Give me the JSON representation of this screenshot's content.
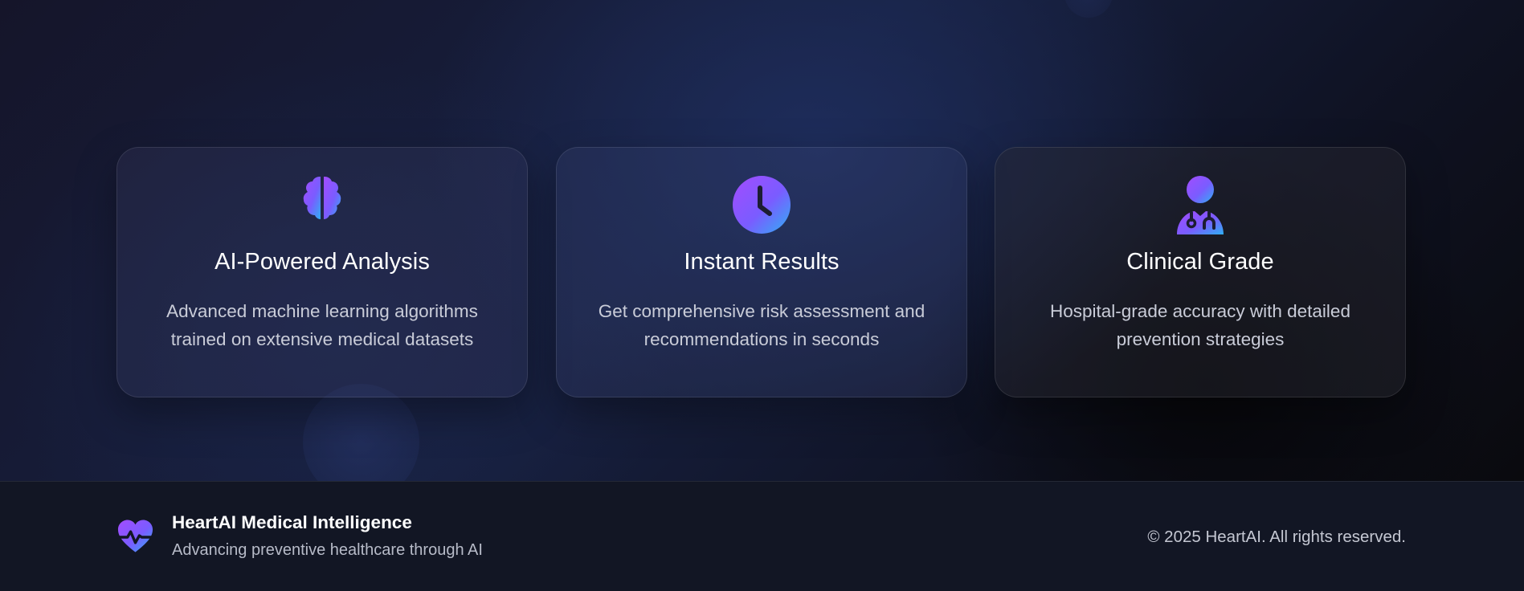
{
  "features": [
    {
      "icon": "brain-icon",
      "title": "AI-Powered Analysis",
      "description": "Advanced machine learning algorithms trained on extensive medical datasets"
    },
    {
      "icon": "clock-icon",
      "title": "Instant Results",
      "description": "Get comprehensive risk assessment and recommendations in seconds"
    },
    {
      "icon": "doctor-icon",
      "title": "Clinical Grade",
      "description": "Hospital-grade accuracy with detailed prevention strategies"
    }
  ],
  "footer": {
    "brand_icon": "heartbeat-icon",
    "brand_name": "HeartAI Medical Intelligence",
    "tagline": "Advancing preventive healthcare through AI",
    "copyright": "© 2025 HeartAI. All rights reserved."
  },
  "colors": {
    "accent_start": "#9b4dff",
    "accent_end": "#3aa0ff"
  }
}
